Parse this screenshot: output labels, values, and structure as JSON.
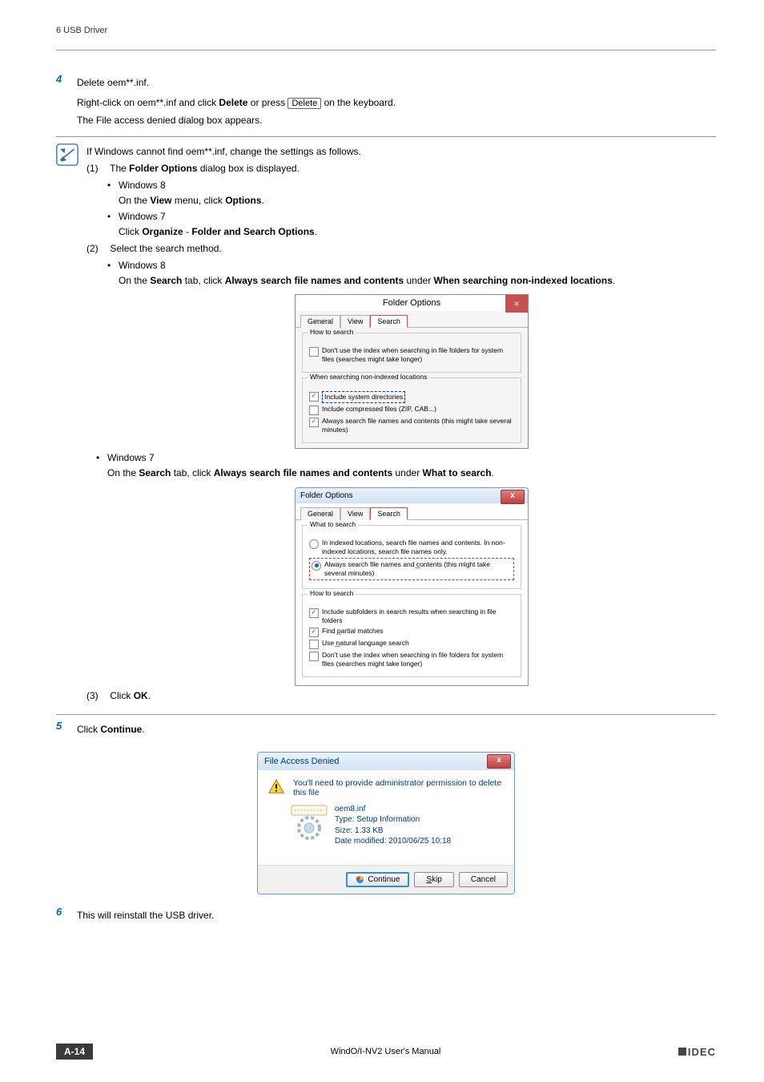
{
  "header": {
    "chapter": "6 USB Driver"
  },
  "step4": {
    "num": "4",
    "title_pre": "Delete oem**.inf.",
    "line1_a": "Right-click on oem**.inf and click ",
    "line1_b": "Delete",
    "line1_c": " or press ",
    "keycap": "Delete",
    "line1_d": " on the keyboard.",
    "line2": "The File access denied dialog box appears."
  },
  "note": {
    "intro": "If Windows cannot find oem**.inf, change the settings as follows.",
    "s1_num": "(1)",
    "s1_a": "The ",
    "s1_b": "Folder Options",
    "s1_c": " dialog box is displayed.",
    "b_win8": "Windows 8",
    "win8_a": "On the ",
    "win8_b": "View",
    "win8_c": " menu, click ",
    "win8_d": "Options",
    "win8_e": ".",
    "b_win7": "Windows 7",
    "win7_a": "Click ",
    "win7_b": "Organize",
    "win7_c": " - ",
    "win7_d": "Folder and Search Options",
    "win7_e": ".",
    "s2_num": "(2)",
    "s2_text": "Select the search method.",
    "s2_win8_a": "On the ",
    "s2_win8_b": "Search",
    "s2_win8_c": " tab, click ",
    "s2_win8_d": "Always search file names and contents",
    "s2_win8_e": " under ",
    "s2_win8_f": "When searching non-indexed locations",
    "s2_win8_g": ".",
    "s2_win7_a": "On the ",
    "s2_win7_b": "Search",
    "s2_win7_c": " tab, click ",
    "s2_win7_d": "Always search file names and contents",
    "s2_win7_e": " under ",
    "s2_win7_f": "What to search",
    "s2_win7_g": ".",
    "s3_num": "(3)",
    "s3_a": "Click ",
    "s3_b": "OK",
    "s3_c": "."
  },
  "folder8": {
    "title": "Folder Options",
    "tab_general": "General",
    "tab_view": "View",
    "tab_search": "Search",
    "g1_legend": "How to search",
    "g1_cb1": "Don't use the index when searching in file folders for system files (searches might take longer)",
    "g2_legend": "When searching non-indexed locations",
    "g2_cb1": "Include system directories",
    "g2_cb2": "Include compressed files (ZIP, CAB...)",
    "g2_cb3": "Always search file names and contents (this might take several minutes)"
  },
  "folder7": {
    "title": "Folder Options",
    "tab_general": "General",
    "tab_view": "View",
    "tab_search": "Search",
    "g1_legend": "What to search",
    "g1_r1": "In indexed locations, search file names and contents. In non-indexed locations, search file names only.",
    "g1_r2": "Always search file names and contents (this might take several minutes)",
    "g2_legend": "How to search",
    "g2_cb1": "Include subfolders in search results when searching in file folders",
    "g2_cb2": "Find partial matches",
    "g2_cb3": "Use natural language search",
    "g2_cb4": "Don't use the index when searching in file folders for system files (searches might take longer)"
  },
  "step5": {
    "num": "5",
    "a": "Click ",
    "b": "Continue",
    "c": "."
  },
  "facc": {
    "title": "File Access Denied",
    "msg": "You'll need to provide administrator permission to delete this file",
    "file_name": "oem8.inf",
    "file_type": "Type: Setup Information",
    "file_size": "Size: 1.33 KB",
    "file_date": "Date modified: 2010/06/25 10:18",
    "btn_continue": "Continue",
    "btn_skip": "Skip",
    "btn_cancel": "Cancel"
  },
  "step6": {
    "num": "6",
    "text": "This will reinstall the USB driver."
  },
  "footer": {
    "page": "A-14",
    "manual": "WindO/I-NV2 User's Manual",
    "brand": "IDEC"
  }
}
